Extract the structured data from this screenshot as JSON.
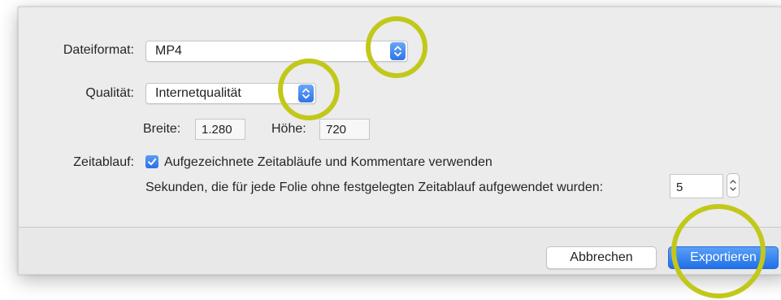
{
  "form": {
    "file_format_label": "Dateiformat:",
    "file_format_value": "MP4",
    "quality_label": "Qualität:",
    "quality_value": "Internetqualität",
    "width_label": "Breite:",
    "width_value": "1.280",
    "height_label": "Höhe:",
    "height_value": "720",
    "timing_label": "Zeitablauf:",
    "use_timings_checked": true,
    "use_timings_label": "Aufgezeichnete Zeitabläufe und Kommentare verwenden",
    "seconds_label": "Sekunden, die für jede Folie ohne festgelegten Zeitablauf aufgewendet wurden:",
    "seconds_value": "5"
  },
  "footer": {
    "cancel_label": "Abbrechen",
    "export_label": "Exportieren"
  },
  "annotations": {
    "highlight_color": "#c2c81a"
  },
  "colors": {
    "accent": "#2f74ea",
    "dialog_bg": "#ececec"
  },
  "icons": {
    "select_stepper": "up-down-chevron-icon",
    "checkbox": "checkmark-icon"
  }
}
